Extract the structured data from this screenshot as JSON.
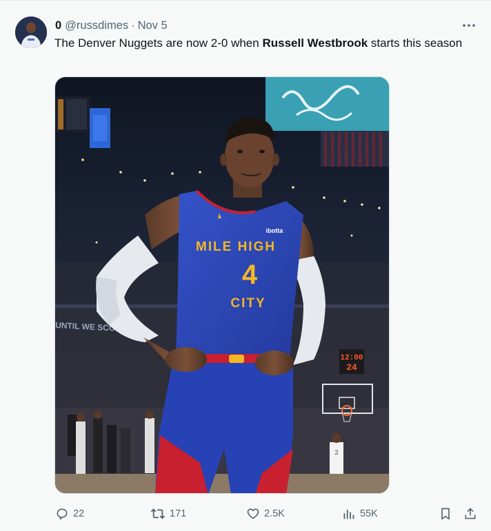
{
  "tweet": {
    "display_name": "0",
    "handle": "@russdimes",
    "separator": "·",
    "date": "Nov 5",
    "text_before": "The Denver Nuggets are now 2-0 when ",
    "text_bold": "Russell Westbrook",
    "text_after": " starts this season"
  },
  "media": {
    "jersey_top": "MILE HIGH",
    "jersey_number": "4",
    "jersey_bottom": "CITY",
    "sponsor": "ibotta",
    "scoreboard_time": "12:00",
    "shot_clock": "24",
    "banner_text": "UNTIL WE SCORE",
    "background_jersey_number": "2"
  },
  "actions": {
    "replies": "22",
    "reposts": "171",
    "likes": "2.5K",
    "views": "55K"
  },
  "colors": {
    "text_primary": "#0f1419",
    "text_secondary": "#536471",
    "background": "#f7f9f9",
    "jersey_blue": "#2a45b8",
    "jersey_red": "#c8202f",
    "jersey_gold": "#f3b724"
  },
  "icons": [
    "more-icon",
    "reply-icon",
    "repost-icon",
    "like-icon",
    "views-icon",
    "bookmark-icon",
    "share-icon"
  ]
}
